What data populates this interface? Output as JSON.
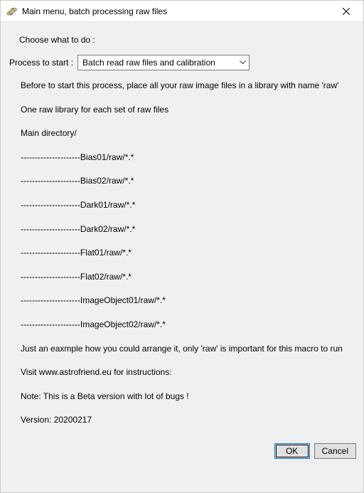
{
  "window": {
    "title": "Main menu, batch processing raw files"
  },
  "prompt": "Choose what to do :",
  "process": {
    "label": "Process to start :",
    "selected": "Batch read raw files and calibration"
  },
  "lines": {
    "l0": "Before to start this process, place all your raw image files in a library with name 'raw'",
    "l1": "One raw library for each set of raw files",
    "l2": "Main directory/",
    "l3": "---------------------Bias01/raw/*.*",
    "l4": "---------------------Bias02/raw/*.*",
    "l5": "---------------------Dark01/raw/*.*",
    "l6": "---------------------Dark02/raw/*.*",
    "l7": "---------------------Flat01/raw/*.*",
    "l8": "---------------------Flat02/raw/*.*",
    "l9": "---------------------ImageObject01/raw/*.*",
    "l10": "---------------------ImageObject02/raw/*.*",
    "l11": "Just an eaxmple how you could arrange it, only 'raw' is important for this macro to run",
    "l12": "Visit www.astrofriend.eu for instructions:",
    "l13": "Note: This is a Beta version with lot of bugs !",
    "l14": "Version: 20200217"
  },
  "buttons": {
    "ok": "OK",
    "cancel": "Cancel"
  }
}
